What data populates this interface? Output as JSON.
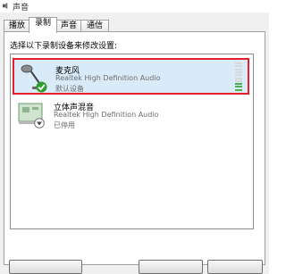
{
  "window": {
    "title": "声音"
  },
  "tabs": [
    {
      "label": "播放"
    },
    {
      "label": "录制"
    },
    {
      "label": "声音"
    },
    {
      "label": "通信"
    }
  ],
  "instruction": "选择以下录制设备来修改设置:",
  "devices": [
    {
      "name": "麦克风",
      "driver": "Realtek High Definition Audio",
      "status": "默认设备",
      "icon": "microphone-icon",
      "badge": "default-check-icon"
    },
    {
      "name": "立体声混音",
      "driver": "Realtek High Definition Audio",
      "status": "已停用",
      "icon": "soundcard-icon",
      "badge": "disabled-down-icon"
    }
  ],
  "level_meter": {
    "level": 0.3
  },
  "colors": {
    "selection_border": "#e41d2a",
    "selection_bg": "#d9ebf9",
    "check_green": "#2e9e2e",
    "meter_green": "#4caf50"
  }
}
